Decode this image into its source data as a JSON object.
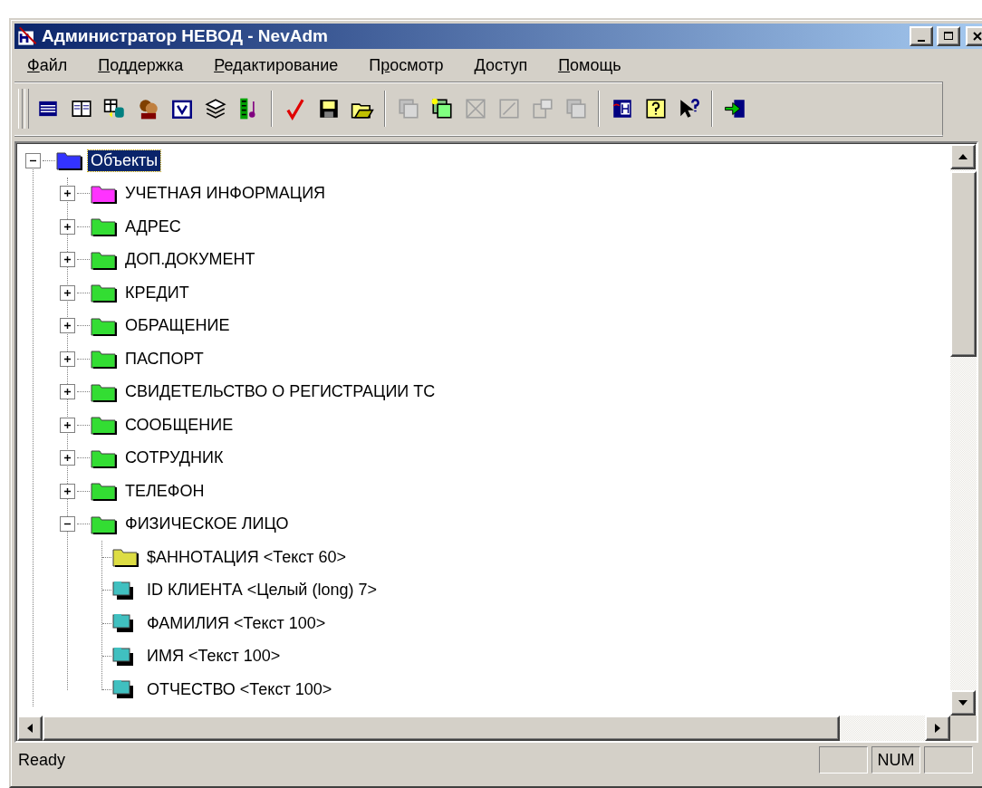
{
  "window": {
    "title": "Администратор НЕВОД - NevAdm"
  },
  "menu": [
    {
      "key": "Ф",
      "after": "айл"
    },
    {
      "key": "П",
      "after": "оддержка"
    },
    {
      "key": "Р",
      "after": "едактирование"
    },
    {
      "before": "П",
      "key": "р",
      "after": "осмотр"
    },
    {
      "key": "Д",
      "after": "оступ"
    },
    {
      "key": "П",
      "after": "омощь"
    }
  ],
  "toolbar": [
    [
      {
        "kind": "list",
        "disabled": false
      },
      {
        "kind": "book",
        "disabled": false
      },
      {
        "kind": "table",
        "disabled": false
      },
      {
        "kind": "people",
        "disabled": false
      },
      {
        "kind": "calendar",
        "disabled": false
      },
      {
        "kind": "stack",
        "disabled": false
      },
      {
        "kind": "film",
        "disabled": false
      }
    ],
    [
      {
        "kind": "check",
        "disabled": false
      },
      {
        "kind": "save",
        "disabled": false
      },
      {
        "kind": "open",
        "disabled": false
      }
    ],
    [
      {
        "kind": "copy",
        "disabled": true
      },
      {
        "kind": "add",
        "disabled": false
      },
      {
        "kind": "cross",
        "disabled": true
      },
      {
        "kind": "edit",
        "disabled": true
      },
      {
        "kind": "props",
        "disabled": true
      },
      {
        "kind": "copy",
        "disabled": true
      }
    ],
    [
      {
        "kind": "helpbook",
        "disabled": false
      },
      {
        "kind": "help",
        "disabled": false
      },
      {
        "kind": "pointer",
        "disabled": false
      }
    ],
    [
      {
        "kind": "exit",
        "disabled": false
      }
    ]
  ],
  "tree": [
    {
      "label": "Объекты",
      "kind": "folder",
      "color": "#3333ff",
      "selected": true,
      "expanded": true,
      "children": [
        {
          "label": "УЧЕТНАЯ ИНФОРМАЦИЯ",
          "kind": "folder",
          "color": "#ff33ff",
          "selected": false,
          "expanded": false
        },
        {
          "label": "АДРЕС",
          "kind": "folder",
          "color": "#33dd33",
          "selected": false,
          "expanded": false
        },
        {
          "label": "ДОП.ДОКУМЕНТ",
          "kind": "folder",
          "color": "#33dd33",
          "selected": false,
          "expanded": false
        },
        {
          "label": "КРЕДИТ",
          "kind": "folder",
          "color": "#33dd33",
          "selected": false,
          "expanded": false
        },
        {
          "label": "ОБРАЩЕНИЕ",
          "kind": "folder",
          "color": "#33dd33",
          "selected": false,
          "expanded": false
        },
        {
          "label": "ПАСПОРТ",
          "kind": "folder",
          "color": "#33dd33",
          "selected": false,
          "expanded": false
        },
        {
          "label": "СВИДЕТЕЛЬСТВО О РЕГИСТРАЦИИ ТС",
          "kind": "folder",
          "color": "#33dd33",
          "selected": false,
          "expanded": false
        },
        {
          "label": "СООБЩЕНИЕ",
          "kind": "folder",
          "color": "#33dd33",
          "selected": false,
          "expanded": false
        },
        {
          "label": "СОТРУДНИК",
          "kind": "folder",
          "color": "#33dd33",
          "selected": false,
          "expanded": false
        },
        {
          "label": "ТЕЛЕФОН",
          "kind": "folder",
          "color": "#33dd33",
          "selected": false,
          "expanded": false
        },
        {
          "label": "ФИЗИЧЕСКОЕ ЛИЦО",
          "kind": "folder",
          "color": "#33dd33",
          "selected": false,
          "expanded": true,
          "children": [
            {
              "label": "$АННОТАЦИЯ <Текст 60>",
              "kind": "folder",
              "color": "#dddd44",
              "selected": false
            },
            {
              "label": "ID КЛИЕНТА <Целый (long) 7>",
              "kind": "field",
              "selected": false
            },
            {
              "label": "ФАМИЛИЯ <Текст 100>",
              "kind": "field",
              "selected": false
            },
            {
              "label": "ИМЯ <Текст 100>",
              "kind": "field",
              "selected": false
            },
            {
              "label": "ОТЧЕСТВО <Текст 100>",
              "kind": "field",
              "selected": false
            }
          ]
        }
      ]
    }
  ],
  "status_bar": {
    "text": "Ready",
    "indicators": [
      {
        "kind": "empty"
      },
      {
        "kind": "text",
        "text": "NUM"
      },
      {
        "kind": "empty"
      }
    ]
  }
}
